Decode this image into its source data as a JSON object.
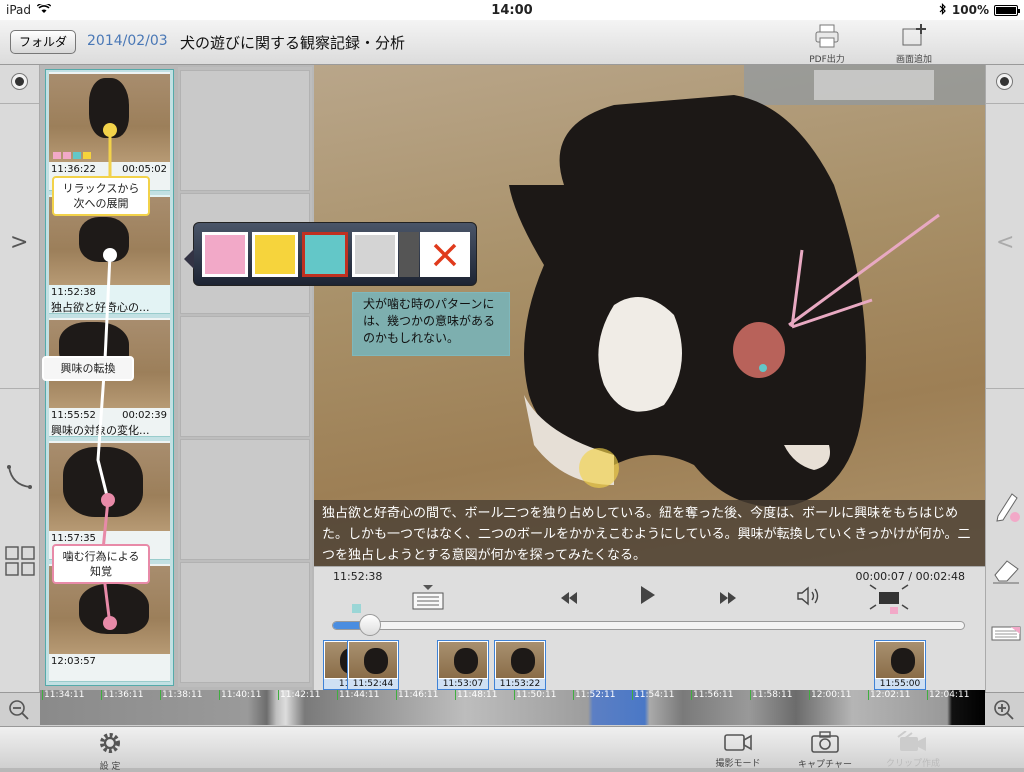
{
  "status": {
    "device": "iPad",
    "time": "14:00",
    "battery": "100%"
  },
  "header": {
    "folder_button": "フォルダ",
    "date": "2014/02/03",
    "title": "犬の遊びに関する観察記録・分析",
    "pdf_label": "PDF出力",
    "add_screen_label": "画面追加"
  },
  "thumbnails": [
    {
      "start": "11:36:22",
      "duration": "00:05:02",
      "text": ""
    },
    {
      "start": "11:52:38",
      "duration": "",
      "text": "独占欲と好奇心の..."
    },
    {
      "start": "11:55:52",
      "duration": "00:02:39",
      "text": "興味の対象の変化..."
    },
    {
      "start": "11:57:35",
      "duration": "",
      "text": ""
    },
    {
      "start": "12:03:57",
      "duration": "",
      "text": ""
    }
  ],
  "annotation_labels": {
    "relax": "リラックスから次への展開",
    "interest": "興味の転換",
    "bite": "噛む行為による知覚"
  },
  "note": "犬が噛む時のパターンには、幾つかの意味があるのかもしれない。",
  "caption": "独占欲と好奇心の間で、ボール二つを独り占めしている。紐を奪った後、今度は、ボールに興味をもちはじめた。しかも一つではなく、二つのボールをかかえこむようにしている。興味が転換していくきっかけが何か。二つを独占しようとする意図が何かを探ってみたくなる。",
  "playback": {
    "current_clock": "11:52:38",
    "position": "00:00:07 / 00:02:48",
    "progress_fraction": 0.05
  },
  "clips": [
    {
      "label": "11:5"
    },
    {
      "label": "11:52:44"
    },
    {
      "label": "11:53:07"
    },
    {
      "label": "11:53:22"
    },
    {
      "label": "11:55:00"
    }
  ],
  "timeline_ticks": [
    "11:34:11",
    "11:36:11",
    "11:38:11",
    "11:40:11",
    "11:42:11",
    "11:44:11",
    "11:46:11",
    "11:48:11",
    "11:50:11",
    "11:52:11",
    "11:54:11",
    "11:56:11",
    "11:58:11",
    "12:00:11",
    "12:02:11",
    "12:04:11"
  ],
  "bottom": {
    "settings": "設 定",
    "shooting_mode": "撮影モード",
    "capture": "キャプチャー",
    "clip_make": "クリップ作成"
  },
  "color_swatches": [
    "#f2a9c8",
    "#f6d43c",
    "#63c7c8",
    "#d4d4d4"
  ],
  "accent_colors": {
    "selection_blue": "#4a8de0",
    "delete_red": "#e03a1c",
    "label_yellow": "#f2d24a",
    "label_pink": "#e88aa8"
  }
}
